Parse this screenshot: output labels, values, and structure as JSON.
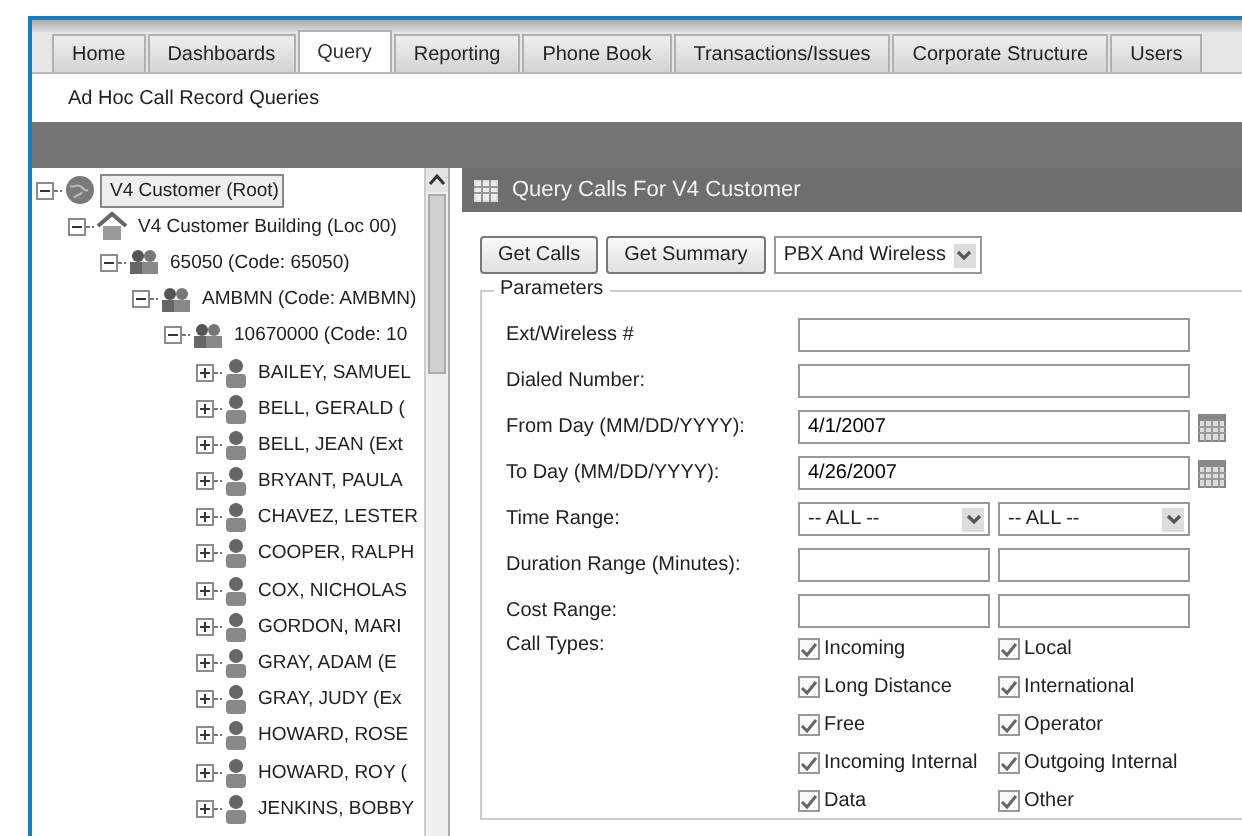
{
  "tabs": [
    {
      "label": "Home",
      "selected": false
    },
    {
      "label": "Dashboards",
      "selected": false
    },
    {
      "label": "Query",
      "selected": true
    },
    {
      "label": "Reporting",
      "selected": false
    },
    {
      "label": "Phone Book",
      "selected": false
    },
    {
      "label": "Transactions/Issues",
      "selected": false
    },
    {
      "label": "Corporate Structure",
      "selected": false
    },
    {
      "label": "Users",
      "selected": false
    }
  ],
  "subnav": "Ad Hoc Call Record Queries",
  "tree": [
    {
      "label": "V4 Customer (Root)",
      "kind": "globe",
      "expanded": true,
      "selected": true,
      "children": [
        {
          "label": "V4 Customer Building (Loc 00)",
          "kind": "building",
          "expanded": true,
          "selected": false,
          "children": [
            {
              "label": "65050 (Code: 65050)",
              "kind": "group",
              "expanded": true,
              "selected": false,
              "children": [
                {
                  "label": "AMBMN (Code: AMBMN)",
                  "kind": "group",
                  "expanded": true,
                  "selected": false,
                  "children": [
                    {
                      "label": "10670000 (Code: 10",
                      "kind": "group",
                      "expanded": true,
                      "selected": false,
                      "children": [
                        {
                          "label": "BAILEY, SAMUEL",
                          "kind": "person",
                          "expanded": false,
                          "selected": false
                        },
                        {
                          "label": "BELL, GERALD (",
                          "kind": "person",
                          "expanded": false,
                          "selected": false
                        },
                        {
                          "label": "BELL, JEAN (Ext",
                          "kind": "person",
                          "expanded": false,
                          "selected": false
                        },
                        {
                          "label": "BRYANT, PAULA",
                          "kind": "person",
                          "expanded": false,
                          "selected": false
                        },
                        {
                          "label": "CHAVEZ, LESTER",
                          "kind": "person",
                          "expanded": false,
                          "selected": false
                        },
                        {
                          "label": "COOPER, RALPH",
                          "kind": "person",
                          "expanded": false,
                          "selected": false
                        },
                        {
                          "label": "COX, NICHOLAS",
                          "kind": "person",
                          "expanded": false,
                          "selected": false
                        },
                        {
                          "label": "GORDON, MARI",
                          "kind": "person",
                          "expanded": false,
                          "selected": false
                        },
                        {
                          "label": "GRAY, ADAM (E",
                          "kind": "person",
                          "expanded": false,
                          "selected": false
                        },
                        {
                          "label": "GRAY, JUDY (Ex",
                          "kind": "person",
                          "expanded": false,
                          "selected": false
                        },
                        {
                          "label": "HOWARD, ROSE",
                          "kind": "person",
                          "expanded": false,
                          "selected": false
                        },
                        {
                          "label": "HOWARD, ROY (",
                          "kind": "person",
                          "expanded": false,
                          "selected": false
                        },
                        {
                          "label": "JENKINS, BOBBY",
                          "kind": "person",
                          "expanded": false,
                          "selected": false
                        }
                      ]
                    }
                  ]
                }
              ]
            }
          ]
        }
      ]
    }
  ],
  "panel": {
    "title": "Query Calls For V4 Customer",
    "buttons": [
      "Get Calls",
      "Get Summary"
    ],
    "source_select": "PBX And Wireless",
    "legend": "Parameters",
    "fields": [
      {
        "kind": "text",
        "label": "Ext/Wireless #"
      },
      {
        "kind": "text",
        "label": "Dialed Number:"
      },
      {
        "kind": "date",
        "label": "From Day (MM/DD/YYYY):",
        "value": "4/1/2007"
      },
      {
        "kind": "date",
        "label": "To Day (MM/DD/YYYY):",
        "value": "4/26/2007"
      },
      {
        "kind": "selects",
        "label": "Time Range:",
        "values": [
          "-- ALL --",
          "-- ALL --"
        ]
      },
      {
        "kind": "range",
        "label": "Duration Range (Minutes):"
      },
      {
        "kind": "range",
        "label": "Cost Range:"
      }
    ],
    "call_types_label": "Call Types:",
    "call_types": [
      {
        "label": "Incoming",
        "checked": true
      },
      {
        "label": "Local",
        "checked": true
      },
      {
        "label": "Long Distance",
        "checked": true
      },
      {
        "label": "International",
        "checked": true
      },
      {
        "label": "Free",
        "checked": true
      },
      {
        "label": "Operator",
        "checked": true
      },
      {
        "label": "Incoming Internal",
        "checked": true
      },
      {
        "label": "Outgoing Internal",
        "checked": true
      },
      {
        "label": "Data",
        "checked": true
      },
      {
        "label": "Other",
        "checked": true
      }
    ]
  }
}
